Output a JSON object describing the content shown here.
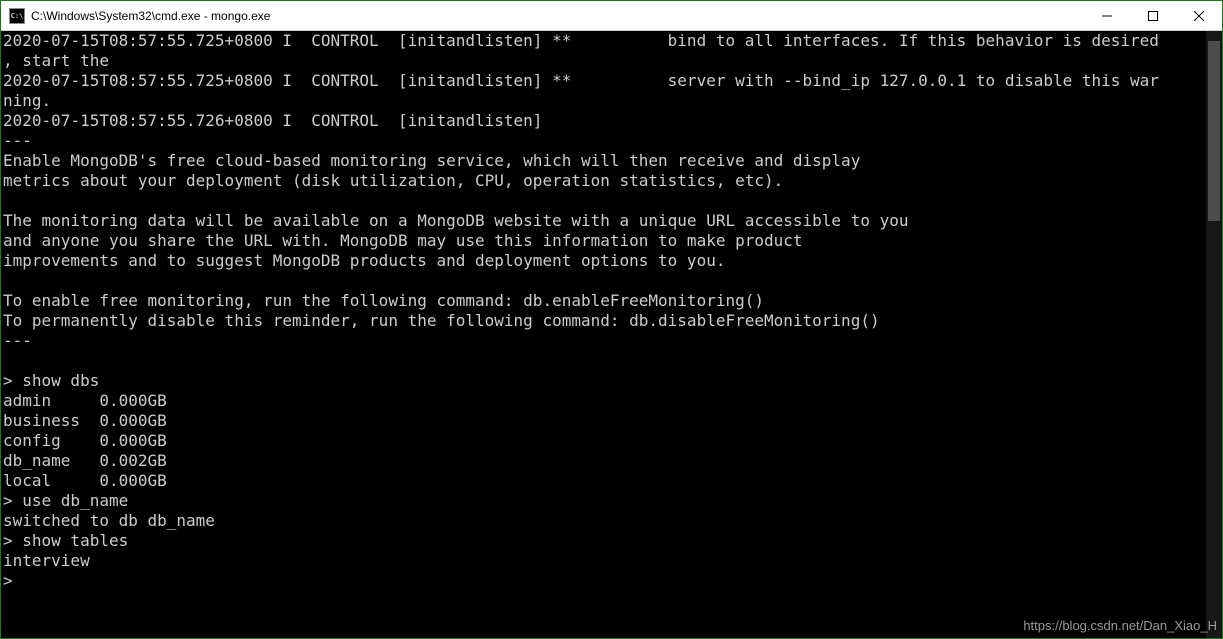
{
  "window": {
    "icon_label": "C:\\",
    "title": "C:\\Windows\\System32\\cmd.exe - mongo.exe"
  },
  "terminal": {
    "lines": [
      "2020-07-15T08:57:55.725+0800 I  CONTROL  [initandlisten] **          bind to all interfaces. If this behavior is desired",
      ", start the",
      "2020-07-15T08:57:55.725+0800 I  CONTROL  [initandlisten] **          server with --bind_ip 127.0.0.1 to disable this war",
      "ning.",
      "2020-07-15T08:57:55.726+0800 I  CONTROL  [initandlisten]",
      "---",
      "Enable MongoDB's free cloud-based monitoring service, which will then receive and display",
      "metrics about your deployment (disk utilization, CPU, operation statistics, etc).",
      "",
      "The monitoring data will be available on a MongoDB website with a unique URL accessible to you",
      "and anyone you share the URL with. MongoDB may use this information to make product",
      "improvements and to suggest MongoDB products and deployment options to you.",
      "",
      "To enable free monitoring, run the following command: db.enableFreeMonitoring()",
      "To permanently disable this reminder, run the following command: db.disableFreeMonitoring()",
      "---",
      "",
      "> show dbs",
      "admin     0.000GB",
      "business  0.000GB",
      "config    0.000GB",
      "db_name   0.002GB",
      "local     0.000GB",
      "> use db_name",
      "switched to db db_name",
      "> show tables",
      "interview",
      ">"
    ]
  },
  "watermark": "https://blog.csdn.net/Dan_Xiao_H"
}
